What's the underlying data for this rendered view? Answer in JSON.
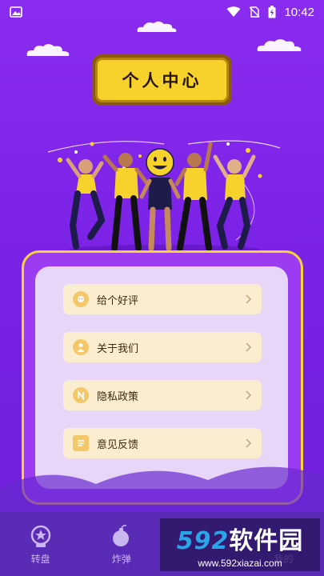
{
  "status_bar": {
    "time": "10:42",
    "icons": [
      "gallery-icon",
      "wifi-icon",
      "no-sim-icon",
      "battery-charging-icon"
    ]
  },
  "header": {
    "title": "个人中心"
  },
  "menu": {
    "items": [
      {
        "label": "给个好评",
        "icon": "review-icon"
      },
      {
        "label": "关于我们",
        "icon": "about-icon"
      },
      {
        "label": "隐私政策",
        "icon": "privacy-icon"
      },
      {
        "label": "意见反馈",
        "icon": "feedback-icon"
      }
    ]
  },
  "bottom_nav": {
    "items": [
      {
        "label": "转盘",
        "icon": "wheel-icon"
      },
      {
        "label": "炸弹",
        "icon": "bomb-icon"
      },
      {
        "label": "",
        "icon": "hidden-tab-icon"
      },
      {
        "label": "我的",
        "icon": "profile-icon"
      }
    ]
  },
  "watermark": {
    "brand_number": "592",
    "brand_text": "软件园",
    "url": "www.592xiazai.com"
  },
  "colors": {
    "background": "#7a22e6",
    "accent_yellow": "#f7d22c",
    "card_border": "#f6d33a",
    "card_fill": "#e8d6f9",
    "menu_item_fill": "#fbeed0",
    "nav_background": "#5a2bb5"
  }
}
